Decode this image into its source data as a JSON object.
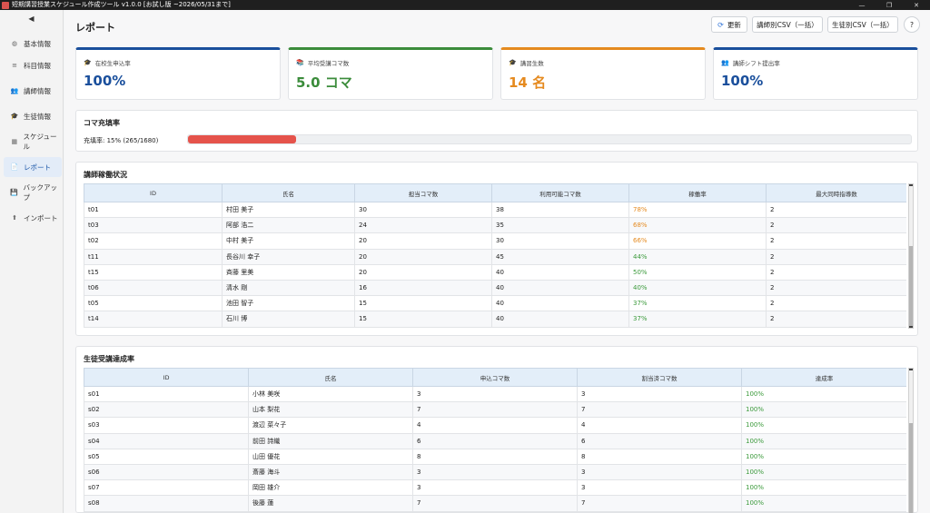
{
  "window": {
    "title": "短期講習授業スケジュール作成ツール v1.0.0 [お試し版 ~2026/05/31まで]"
  },
  "sidebar": {
    "collapse_label": "◀",
    "items": [
      {
        "label": "基本情報",
        "icon": "◍"
      },
      {
        "label": "科目情報",
        "icon": "≡"
      },
      {
        "label": "講師情報",
        "icon": "👥"
      },
      {
        "label": "生徒情報",
        "icon": "🎓"
      },
      {
        "label": "スケジュール",
        "icon": "▦"
      },
      {
        "label": "レポート",
        "icon": "📄"
      },
      {
        "label": "バックアップ",
        "icon": "💾"
      },
      {
        "label": "インポート",
        "icon": "⬆"
      }
    ],
    "active_index": 5
  },
  "header": {
    "title": "レポート",
    "refresh_label": "更新",
    "teacher_csv_label": "講師別CSV（一括）",
    "student_csv_label": "生徒別CSV（一括）",
    "help_label": "?"
  },
  "stats": [
    {
      "label": "在校生申込率",
      "value": "100%",
      "color": "#1a4f9c",
      "icon": "🎓"
    },
    {
      "label": "平均受講コマ数",
      "value": "5.0 コマ",
      "color": "#3b8c3b",
      "icon": "📚"
    },
    {
      "label": "講習生数",
      "value": "14 名",
      "color": "#e58a1f",
      "icon": "🎓"
    },
    {
      "label": "講師シフト提出率",
      "value": "100%",
      "color": "#1a4f9c",
      "icon": "👥"
    }
  ],
  "fill_rate": {
    "title": "コマ充填率",
    "text": "充填率: 15%  (265/1680)",
    "percent": 15,
    "bar_color": "#e5534b"
  },
  "teacher_table": {
    "title": "講師稼働状況",
    "columns": [
      "ID",
      "氏名",
      "担当コマ数",
      "利用可能コマ数",
      "稼働率",
      "最大同時指導数"
    ],
    "rows": [
      [
        "t01",
        "村田 美子",
        "30",
        "38",
        "78%",
        "2"
      ],
      [
        "t03",
        "阿部 浩二",
        "24",
        "35",
        "68%",
        "2"
      ],
      [
        "t02",
        "中村 美子",
        "20",
        "30",
        "66%",
        "2"
      ],
      [
        "t11",
        "長谷川 幸子",
        "20",
        "45",
        "44%",
        "2"
      ],
      [
        "t15",
        "斉藤 里美",
        "20",
        "40",
        "50%",
        "2"
      ],
      [
        "t06",
        "清水 剛",
        "16",
        "40",
        "40%",
        "2"
      ],
      [
        "t05",
        "池田 智子",
        "15",
        "40",
        "37%",
        "2"
      ],
      [
        "t14",
        "石川 博",
        "15",
        "40",
        "37%",
        "2"
      ]
    ],
    "rate_colors": [
      "#e58a1f",
      "#e58a1f",
      "#e58a1f",
      "#3b9a3b",
      "#3b9a3b",
      "#3b9a3b",
      "#3b9a3b",
      "#3b9a3b"
    ]
  },
  "student_table": {
    "title": "生徒受講達成率",
    "columns": [
      "ID",
      "氏名",
      "申込コマ数",
      "割当済コマ数",
      "達成率"
    ],
    "rows": [
      [
        "s01",
        "小林 美咲",
        "3",
        "3",
        "100%"
      ],
      [
        "s02",
        "山本 梨花",
        "7",
        "7",
        "100%"
      ],
      [
        "s03",
        "渡辺 菜々子",
        "4",
        "4",
        "100%"
      ],
      [
        "s04",
        "前田 詩織",
        "6",
        "6",
        "100%"
      ],
      [
        "s05",
        "山田 優花",
        "8",
        "8",
        "100%"
      ],
      [
        "s06",
        "斎藤 海斗",
        "3",
        "3",
        "100%"
      ],
      [
        "s07",
        "岡田 雄介",
        "3",
        "3",
        "100%"
      ],
      [
        "s08",
        "後藤 蓮",
        "7",
        "7",
        "100%"
      ]
    ],
    "rate_color": "#3b9a3b"
  }
}
